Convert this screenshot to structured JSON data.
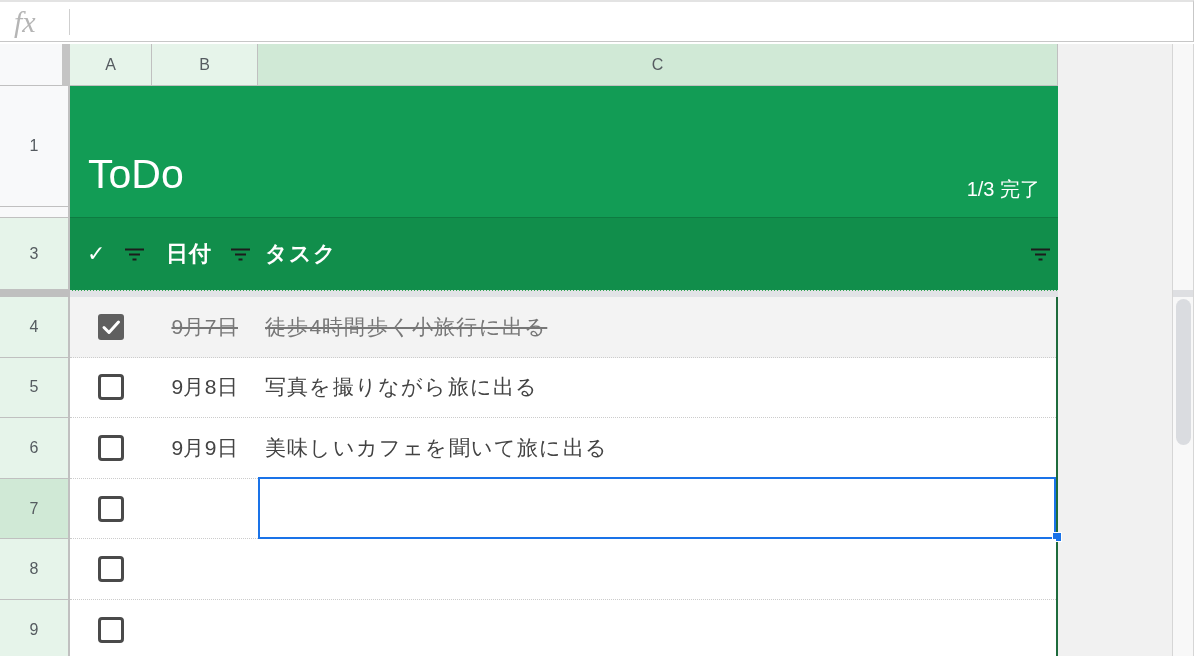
{
  "formula_bar": {
    "label": "fx"
  },
  "column_headers": [
    {
      "label": "A",
      "selected": false
    },
    {
      "label": "B",
      "selected": false
    },
    {
      "label": "C",
      "selected": true
    }
  ],
  "title_row": {
    "row_number": "1",
    "title": "ToDo",
    "progress": "1/3 完了"
  },
  "header_row": {
    "row_number": "3",
    "columns": [
      {
        "label": "✓"
      },
      {
        "label": "日付"
      },
      {
        "label": "タスク"
      }
    ]
  },
  "rows": [
    {
      "row_number": "4",
      "checked": true,
      "selected": false,
      "date": "9月7日",
      "task": "徒歩4時間歩く小旅行に出る"
    },
    {
      "row_number": "5",
      "checked": false,
      "selected": false,
      "date": "9月8日",
      "task": "写真を撮りながら旅に出る"
    },
    {
      "row_number": "6",
      "checked": false,
      "selected": false,
      "date": "9月9日",
      "task": "美味しいカフェを聞いて旅に出る"
    },
    {
      "row_number": "7",
      "checked": false,
      "selected": true
    },
    {
      "row_number": "8",
      "checked": false,
      "selected": false
    },
    {
      "row_number": "9",
      "checked": false,
      "selected": false
    }
  ]
}
